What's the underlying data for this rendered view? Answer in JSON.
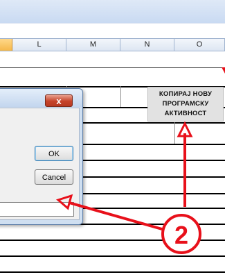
{
  "spreadsheet": {
    "columns": [
      "",
      "L",
      "M",
      "N",
      "O"
    ],
    "selected_column_index": 0
  },
  "sheet_button": {
    "lines": [
      "КОПИРАЈ НОВУ",
      "ПРОГРАМСКУ",
      "АКТИВНОСТ"
    ]
  },
  "dialog": {
    "close_label": "x",
    "ok_label": "OK",
    "cancel_label": "Cancel",
    "input_value": ""
  },
  "annotation": {
    "marker": "2",
    "color": "#e8101a"
  }
}
